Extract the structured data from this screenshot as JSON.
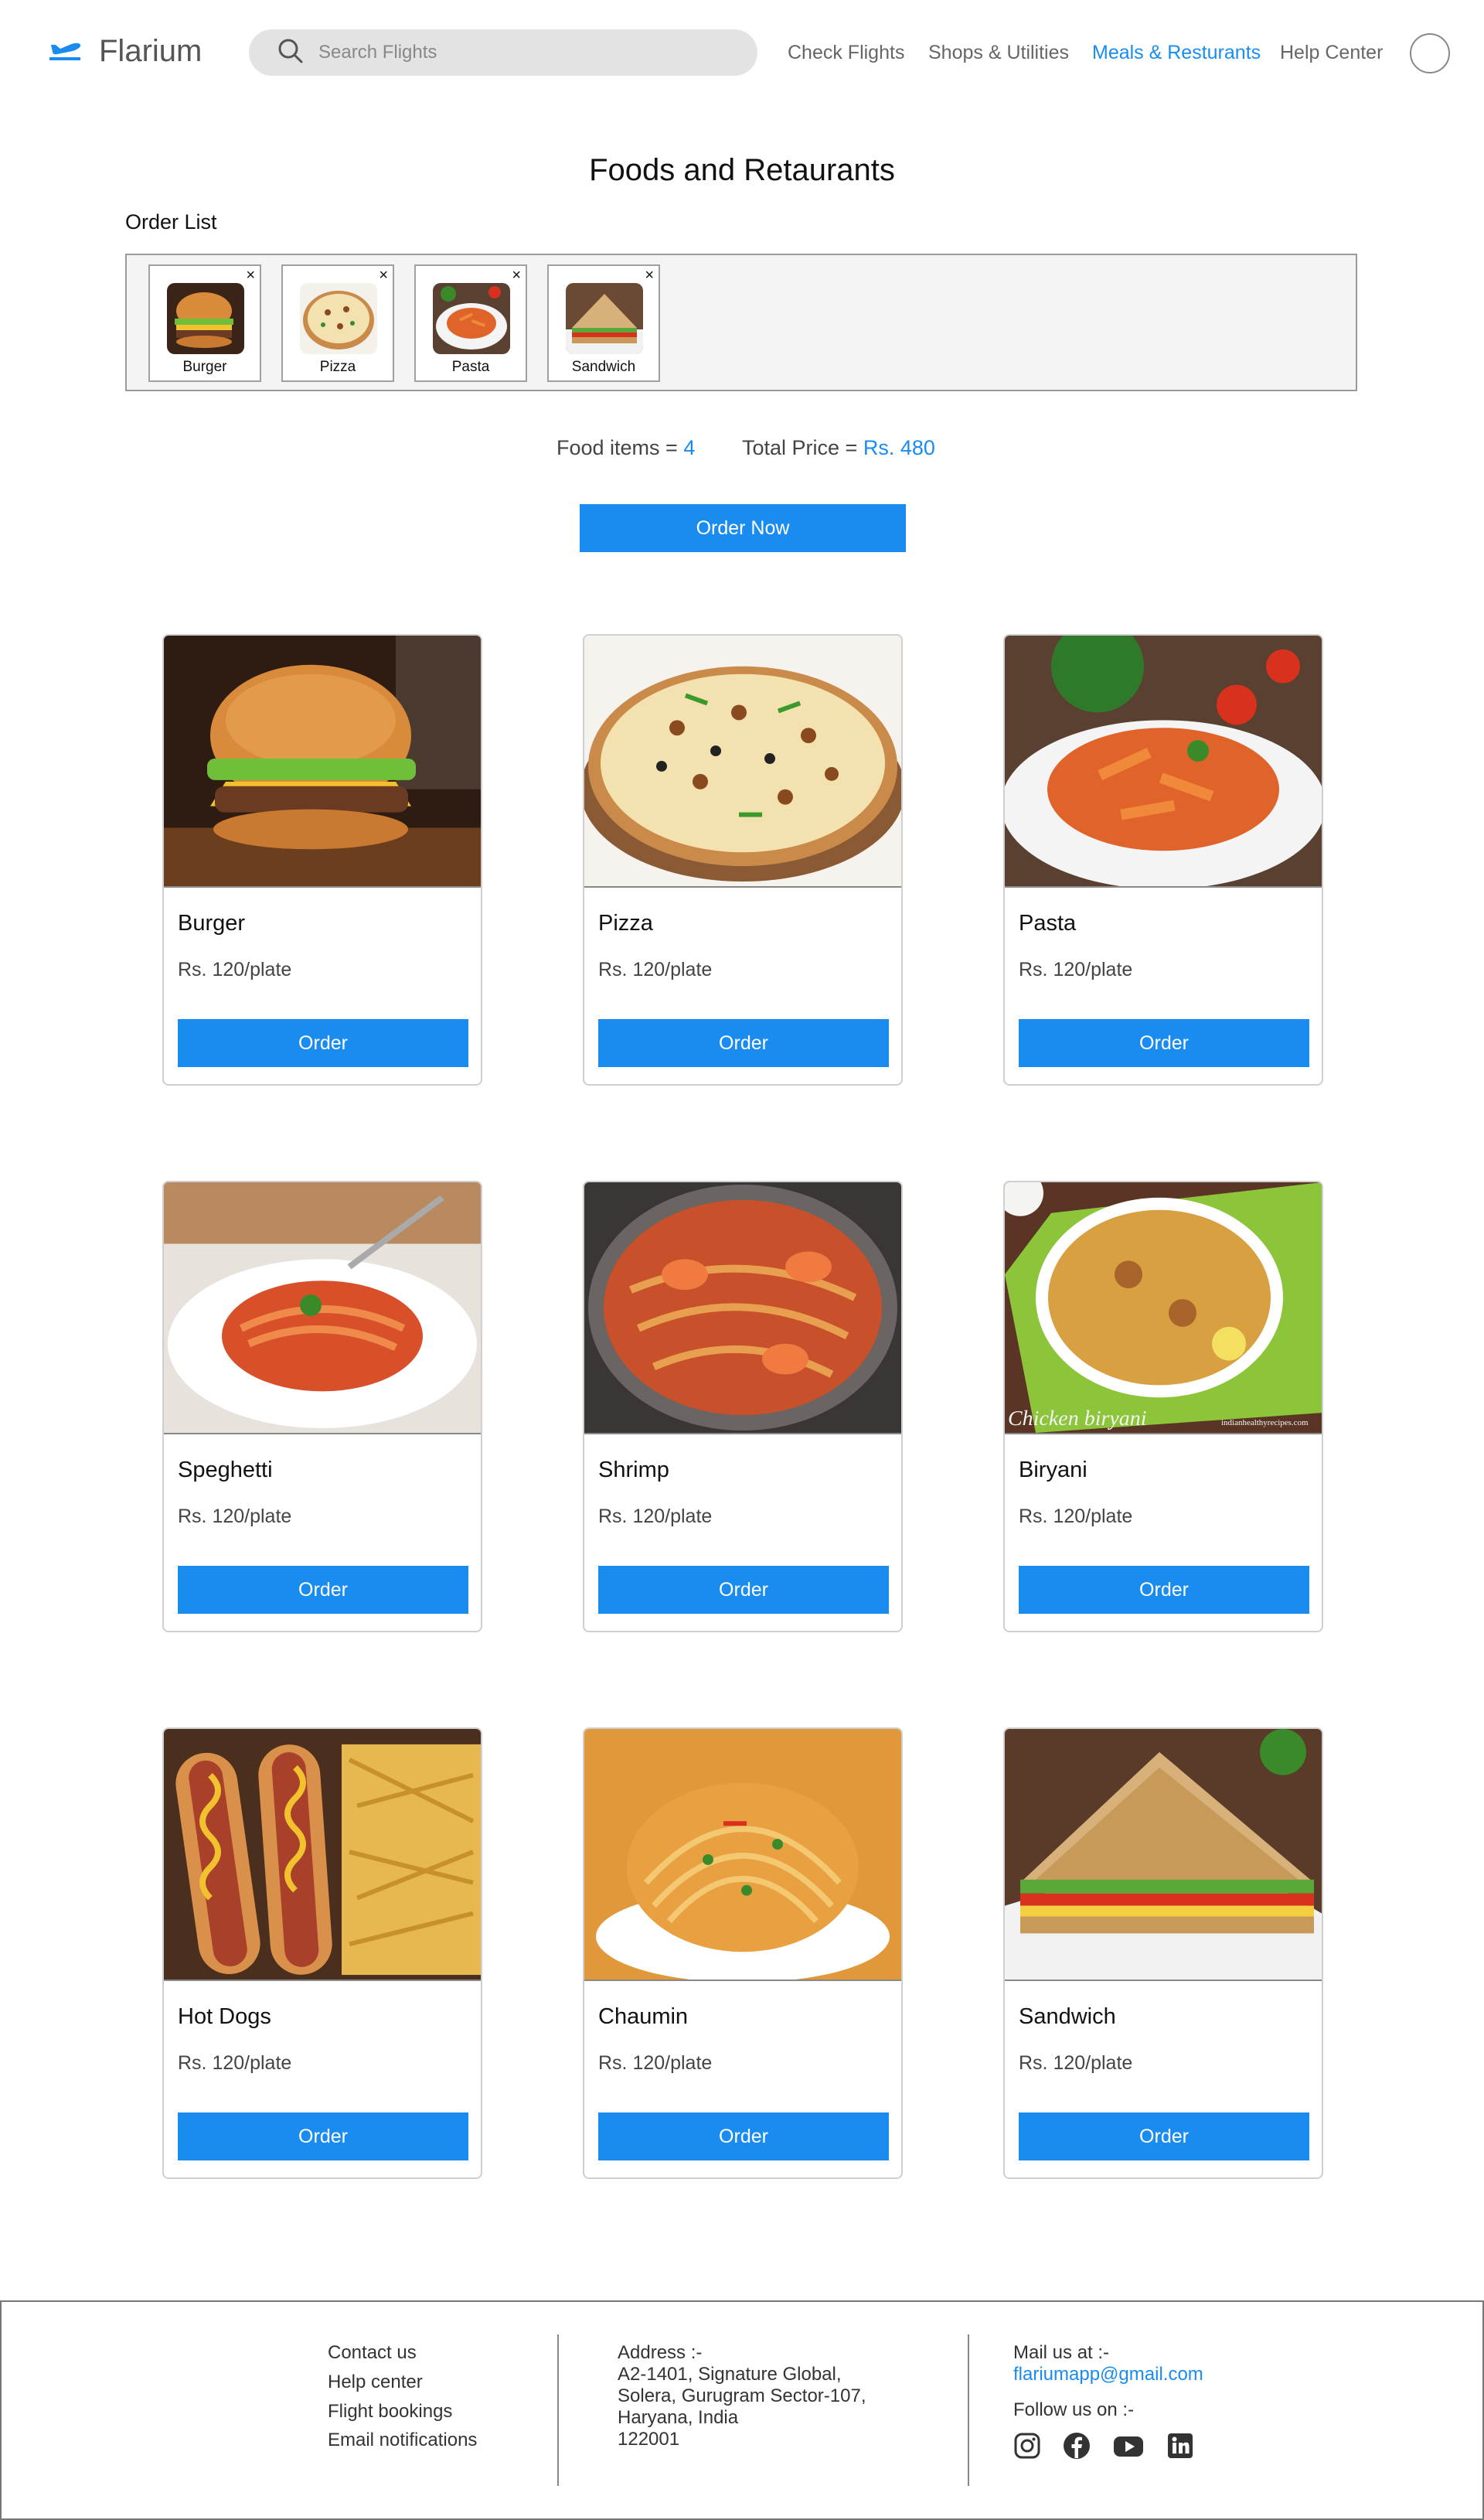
{
  "header": {
    "brand": "Flarium",
    "search_placeholder": "Search Flights",
    "nav": [
      "Check Flights",
      "Shops & Utilities",
      "Meals & Resturants",
      "Help Center"
    ],
    "active_nav": "Meals & Resturants"
  },
  "page": {
    "title": "Foods and Retaurants",
    "order_list_label": "Order List"
  },
  "order_list": [
    {
      "name": "Burger",
      "close": "×"
    },
    {
      "name": "Pizza",
      "close": "×"
    },
    {
      "name": "Pasta",
      "close": "×"
    },
    {
      "name": "Sandwich",
      "close": "×"
    }
  ],
  "summary": {
    "items_label": "Food items = ",
    "items_value": "4",
    "price_label": "Total Price = ",
    "price_value": "Rs. 480",
    "order_now": "Order Now"
  },
  "foods": [
    {
      "name": "Burger",
      "price": "Rs. 120/plate",
      "button": "Order"
    },
    {
      "name": "Pizza",
      "price": "Rs. 120/plate",
      "button": "Order"
    },
    {
      "name": "Pasta",
      "price": "Rs. 120/plate",
      "button": "Order"
    },
    {
      "name": "Speghetti",
      "price": "Rs. 120/plate",
      "button": "Order"
    },
    {
      "name": "Shrimp",
      "price": "Rs. 120/plate",
      "button": "Order"
    },
    {
      "name": "Biryani",
      "price": "Rs. 120/plate",
      "button": "Order"
    },
    {
      "name": "Hot Dogs",
      "price": "Rs. 120/plate",
      "button": "Order"
    },
    {
      "name": "Chaumin",
      "price": "Rs. 120/plate",
      "button": "Order"
    },
    {
      "name": "Sandwich",
      "price": "Rs. 120/plate",
      "button": "Order"
    }
  ],
  "food_image_texts": {
    "biryani_caption": "Chicken biryani",
    "biryani_watermark": "indianhealthyrecipes.com"
  },
  "footer": {
    "links": [
      "Contact us",
      "Help center",
      "Flight bookings",
      "Email notifications"
    ],
    "address": [
      "Address :-",
      "A2-1401, Signature Global,",
      "Solera, Gurugram Sector-107,",
      "Haryana, India",
      "122001"
    ],
    "mail_label": "Mail us at :-",
    "mail": "flariumapp@gmail.com",
    "follow_label": "Follow us on :-",
    "social_icons": [
      "instagram-icon",
      "facebook-icon",
      "youtube-icon",
      "linkedin-icon"
    ]
  },
  "colors": {
    "accent": "#1a8cf0",
    "search_bg": "#e3e3e3",
    "order_box_bg": "#f4f4f4"
  }
}
